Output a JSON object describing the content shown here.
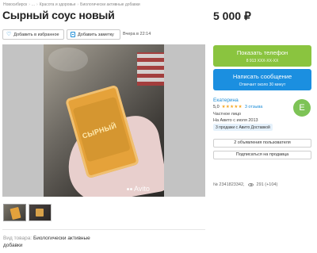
{
  "breadcrumb": {
    "items": [
      "Новосибирск",
      "...",
      "Красота и здоровье",
      "Биологически активные добавки"
    ]
  },
  "listing": {
    "title": "Сырный соус новый",
    "price": "5 000 ₽",
    "posted": "Вчера в 22:14",
    "number": "№ 2341823342,",
    "views": "291 (+104)"
  },
  "actions": {
    "favorite_label": "Добавить в избранное",
    "note_label": "Добавить заметку"
  },
  "gallery": {
    "watermark": "Avito",
    "photo_label": "СЫРНЫЙ"
  },
  "contact": {
    "phone_label": "Показать телефон",
    "phone_masked": "8 913 XXX-XX-XX",
    "message_label": "Написать сообщение",
    "message_sub": "Отвечает около 30 минут"
  },
  "seller": {
    "name": "Екатерина",
    "rating": "5,0",
    "stars": "★★★★★",
    "reviews": "3 отзыва",
    "type": "Частное лицо",
    "since": "На Авито с июля 2013",
    "delivery": "3 продажи с Авито Доставкой",
    "avatar_letter": "E",
    "avatar_color": "#7dc356",
    "ads_label": "2 объявления пользователя",
    "subscribe_label": "Подписаться на продавца"
  },
  "specs": {
    "label": "Вид товара:",
    "value_line1": "Биологически активные",
    "value_line2": "добавки"
  },
  "colors": {
    "phone_button": "#8ac43f",
    "message_button": "#1b8fe0",
    "link": "#1b8cd6"
  }
}
